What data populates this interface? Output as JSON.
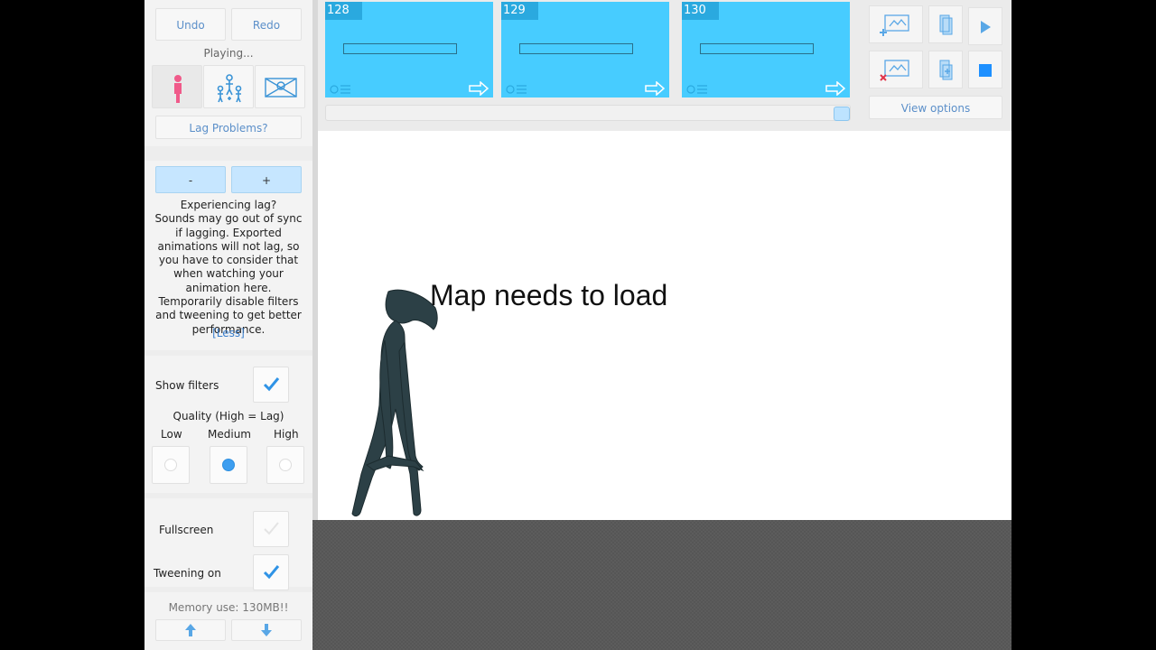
{
  "history": {
    "undo_label": "Undo",
    "redo_label": "Redo",
    "status": "Playing..."
  },
  "modes": {
    "selected": "single-figure"
  },
  "lag": {
    "problems_label": "Lag Problems?",
    "minus_label": "-",
    "plus_label": "+",
    "help_text": "Experiencing lag?\nSounds may go out of sync if lagging. Exported animations will not lag, so you have to consider that when watching your animation here.\nTemporarily disable filters and tweening to get better performance.",
    "less_label": "[Less]"
  },
  "filters": {
    "show_filters_label": "Show filters",
    "show_filters_checked": true,
    "quality_label": "Quality (High = Lag)",
    "low_label": "Low",
    "medium_label": "Medium",
    "high_label": "High",
    "selected_quality": "Medium"
  },
  "options": {
    "fullscreen_label": "Fullscreen",
    "fullscreen_checked": false,
    "tweening_label": "Tweening on",
    "tweening_checked": true
  },
  "memory": {
    "label": "Memory use: 130MB!!"
  },
  "timeline": {
    "frames": [
      {
        "number": "128"
      },
      {
        "number": "129"
      },
      {
        "number": "130"
      }
    ],
    "view_options_label": "View options"
  },
  "canvas": {
    "text": "Map needs to load"
  },
  "colors": {
    "accent": "#47ccff",
    "link": "#5b8fc9",
    "stop": "#1e90ff",
    "figure": "#2c4046"
  }
}
